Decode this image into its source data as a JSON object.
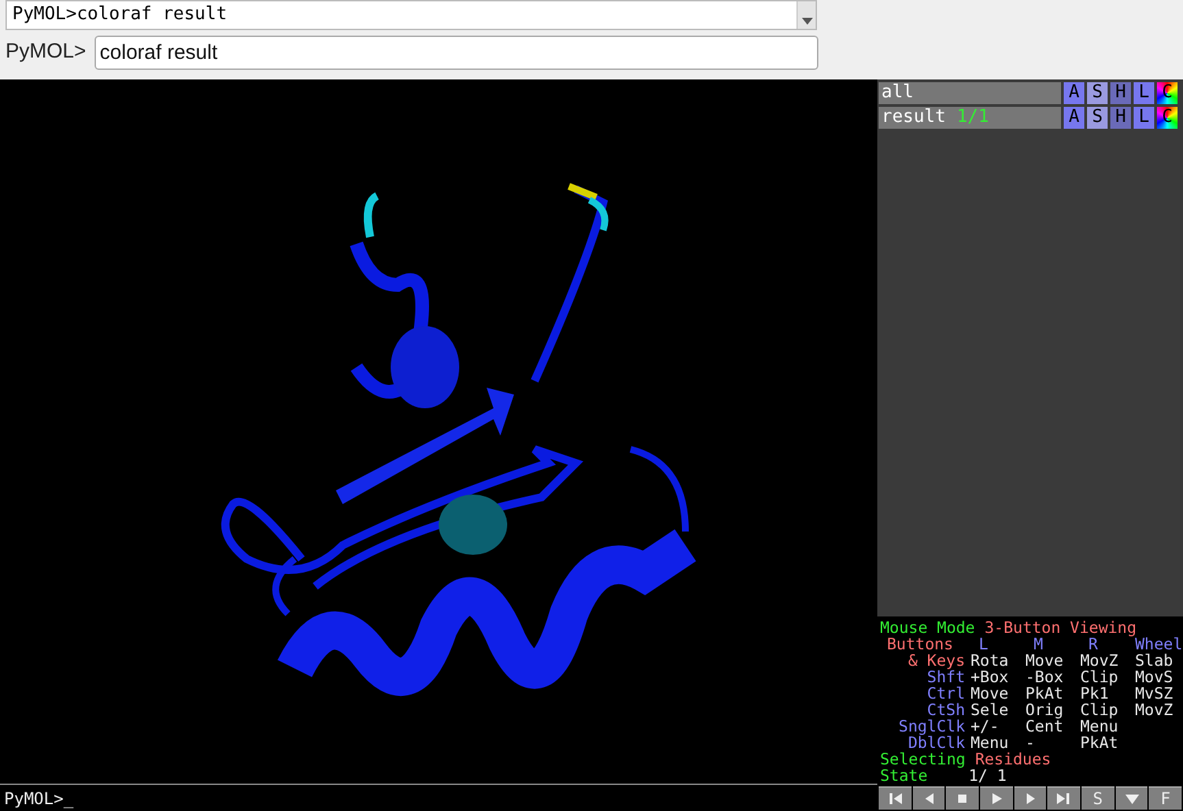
{
  "log": {
    "lines": [
      "PyMOL>coloraf result"
    ]
  },
  "command": {
    "label": "PyMOL>",
    "value": "coloraf result"
  },
  "objects": [
    {
      "name": "all",
      "buttons": [
        "A",
        "S",
        "H",
        "L",
        "C"
      ]
    },
    {
      "name": "result",
      "state": "1/1",
      "buttons": [
        "A",
        "S",
        "H",
        "L",
        "C"
      ]
    }
  ],
  "mouse_mode": {
    "title": "Mouse Mode",
    "mode": "3-Button Viewing",
    "header": [
      {
        "text": "Buttons",
        "color": "#ff7070"
      },
      {
        "text": "L",
        "color": "#8080ff"
      },
      {
        "text": "M",
        "color": "#8080ff"
      },
      {
        "text": "R",
        "color": "#8080ff"
      },
      {
        "text": "Wheel",
        "color": "#8080ff"
      }
    ],
    "rows": [
      {
        "label": "& Keys",
        "color": "#ff7070",
        "cells": [
          "Rota",
          "Move",
          "MovZ",
          "Slab"
        ]
      },
      {
        "label": "Shft",
        "color": "#8080ff",
        "cells": [
          "+Box",
          "-Box",
          "Clip",
          "MovS"
        ]
      },
      {
        "label": "Ctrl",
        "color": "#8080ff",
        "cells": [
          "Move",
          "PkAt",
          "Pk1",
          "MvSZ"
        ]
      },
      {
        "label": "CtSh",
        "color": "#8080ff",
        "cells": [
          "Sele",
          "Orig",
          "Clip",
          "MovZ"
        ]
      },
      {
        "label": "SnglClk",
        "color": "#8080ff",
        "cells": [
          "+/-",
          "Cent",
          "Menu"
        ]
      },
      {
        "label": "DblClk",
        "color": "#8080ff",
        "cells": [
          "Menu",
          "-",
          "PkAt"
        ]
      }
    ],
    "selecting": {
      "label": "Selecting",
      "value": "Residues"
    },
    "state": {
      "label": "State",
      "value": "1/ 1"
    }
  },
  "playback": [
    {
      "kind": "first"
    },
    {
      "kind": "back"
    },
    {
      "kind": "stop"
    },
    {
      "kind": "play"
    },
    {
      "kind": "forward"
    },
    {
      "kind": "last"
    },
    {
      "kind": "text",
      "text": "S"
    },
    {
      "kind": "down"
    },
    {
      "kind": "text",
      "text": "F"
    }
  ],
  "console": {
    "prompt": "PyMOL>_"
  }
}
